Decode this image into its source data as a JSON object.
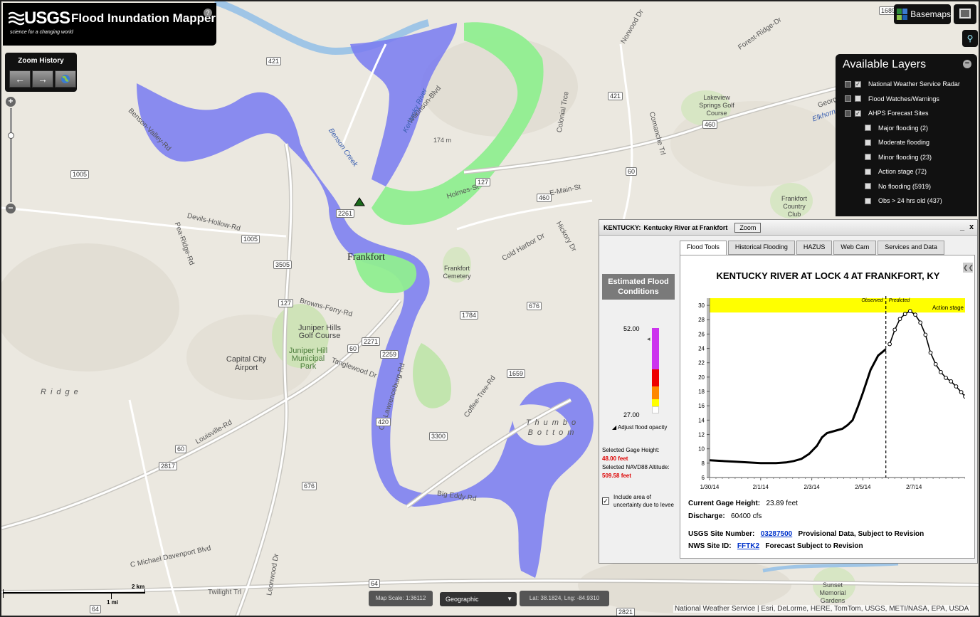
{
  "header": {
    "logo": "USGS",
    "tagline": "science for a changing world",
    "title": "Flood Inundation Mapper",
    "help": "?"
  },
  "zoom_history": {
    "label": "Zoom History",
    "back": "←",
    "forward": "→"
  },
  "zoom_slider": {
    "plus": "+",
    "minus": "−"
  },
  "basemaps": {
    "label": "Basemaps"
  },
  "layers": {
    "title": "Available Layers",
    "items": [
      {
        "label": "National Weather Service Radar",
        "checked": true,
        "level": 0
      },
      {
        "label": "Flood Watches/Warnings",
        "checked": false,
        "level": 0
      },
      {
        "label": "AHPS Forecast Sites",
        "checked": true,
        "level": 0
      },
      {
        "label": "Major flooding (2)",
        "checked": false,
        "level": 1
      },
      {
        "label": "Moderate flooding",
        "checked": false,
        "level": 1
      },
      {
        "label": "Minor flooding (23)",
        "checked": false,
        "level": 1
      },
      {
        "label": "Action stage (72)",
        "checked": false,
        "level": 1
      },
      {
        "label": "No flooding (5919)",
        "checked": false,
        "level": 1
      },
      {
        "label": "Obs > 24 hrs old (437)",
        "checked": false,
        "level": 1
      }
    ]
  },
  "panel": {
    "state": "KENTUCKY:",
    "site": "Kentucky River at Frankfort",
    "zoom": "Zoom",
    "minimize": "_",
    "close": "x",
    "tabs": [
      "Flood Tools",
      "Historical Flooding",
      "HAZUS",
      "Web Cam",
      "Services and Data"
    ],
    "efc_title": "Estimated Flood Conditions",
    "scale_top": "52.00",
    "scale_bottom": "27.00",
    "adjust_opacity": "Adjust flood opacity",
    "gage_height_label": "Selected Gage Height:",
    "gage_height_value": "48.00 feet",
    "navd_label": "Selected NAVD88 Altitude:",
    "navd_value": "509.58 feet",
    "levee_text": "Include area of uncertainty due to levee",
    "levee_checked": true,
    "current_gage_label": "Current Gage Height:",
    "current_gage_value": "23.89 feet",
    "discharge_label": "Discharge:",
    "discharge_value": "60400 cfs",
    "usgs_site_label": "USGS Site Number:",
    "usgs_site_link": "03287500",
    "usgs_site_note": "Provisional Data, Subject to Revision",
    "nws_site_label": "NWS Site ID:",
    "nws_site_link": "FFTK2",
    "nws_site_note": "Forecast Subject to Revision"
  },
  "chart_data": {
    "type": "line",
    "title": "KENTUCKY RIVER AT LOCK 4 AT FRANKFORT, KY",
    "x_ticks": [
      "1/30/14",
      "2/1/14",
      "2/3/14",
      "2/5/14",
      "2/7/14"
    ],
    "ylim": [
      6,
      31
    ],
    "y_ticks": [
      6,
      8,
      10,
      12,
      14,
      16,
      18,
      20,
      22,
      24,
      26,
      28,
      30
    ],
    "action_stage": {
      "from": 29,
      "to": 31,
      "label": "Action stage",
      "color": "#ffff00"
    },
    "divider_label_left": "Observed",
    "divider_label_right": "Predicted",
    "divider_x": 6.9,
    "observed": [
      [
        0,
        8.4
      ],
      [
        0.5,
        8.3
      ],
      [
        1,
        8.2
      ],
      [
        1.5,
        8.1
      ],
      [
        2,
        8.0
      ],
      [
        2.6,
        8.0
      ],
      [
        3.0,
        8.1
      ],
      [
        3.3,
        8.3
      ],
      [
        3.6,
        8.6
      ],
      [
        3.9,
        9.3
      ],
      [
        4.2,
        10.4
      ],
      [
        4.4,
        11.6
      ],
      [
        4.6,
        12.2
      ],
      [
        4.9,
        12.5
      ],
      [
        5.2,
        12.8
      ],
      [
        5.4,
        13.3
      ],
      [
        5.6,
        14.0
      ],
      [
        5.8,
        15.8
      ],
      [
        6.0,
        17.8
      ],
      [
        6.3,
        21.0
      ],
      [
        6.6,
        23.0
      ],
      [
        6.9,
        23.89
      ]
    ],
    "predicted": [
      [
        7.05,
        24.6
      ],
      [
        7.25,
        26.6
      ],
      [
        7.45,
        28.1
      ],
      [
        7.65,
        28.8
      ],
      [
        7.85,
        29.2
      ],
      [
        8.05,
        28.7
      ],
      [
        8.25,
        27.6
      ],
      [
        8.45,
        25.9
      ],
      [
        8.65,
        23.4
      ],
      [
        8.85,
        21.8
      ],
      [
        9.05,
        20.7
      ],
      [
        9.25,
        19.9
      ],
      [
        9.45,
        19.4
      ],
      [
        9.65,
        18.7
      ],
      [
        9.85,
        17.9
      ],
      [
        10.0,
        17.3
      ]
    ],
    "x_max": 10.0,
    "grid": false,
    "legend": "none"
  },
  "bottom": {
    "scale_km": "2 km",
    "scale_mi": "1 mi",
    "map_scale": "Map Scale: 1:36112",
    "projection": "Geographic",
    "latlng": "Lat: 38.1824, Lng: -84.9310",
    "attribution": "National Weather Service | Esri, DeLorme, HERE, TomTom, USGS, METI/NASA, EPA, USDA"
  },
  "map": {
    "places": [
      "Frankfort",
      "Juniper Hills Golf Course",
      "Juniper Hill Municipal Park",
      "Capital City Airport",
      "Frankfort Cemetery",
      "Lakeview Springs Golf Course",
      "Frankfort Country Club",
      "Sunset Memorial Gardens"
    ],
    "roads": [
      "Devils-Hollow-Rd",
      "Louisville-Rd",
      "Holmes-St",
      "E-Main-St",
      "Wilkinson-Blvd",
      "Browns-Ferry-Rd",
      "Benson-Valley-Rd",
      "Old-Lawrenceburg-Rd",
      "Coffee-Tree-Rd",
      "C Michael Davenport Blvd",
      "Twilight Trl",
      "Big Eddy Rd",
      "Pea-Ridge-Rd",
      "Tanglewood Dr",
      "Georgetown",
      "Cold Harbor Dr",
      "Hickory Dr",
      "Leonwood Dr",
      "Norwood Dr",
      "Forest-Ridge-Dr",
      "Colonial Trce",
      "Comanche Trl"
    ],
    "water": [
      "Kentucky River",
      "Benson Creek",
      "Elkhorn Creek"
    ],
    "area": "Thumbo Bottom",
    "ridge": "Ridge",
    "elev": "174 m",
    "shields": [
      "421",
      "421",
      "1005",
      "1005",
      "3505",
      "127",
      "127",
      "60",
      "60",
      "460",
      "460",
      "2261",
      "2271",
      "2259",
      "1784",
      "676",
      "676",
      "1659",
      "420",
      "3300",
      "2817",
      "60",
      "64",
      "64",
      "2821",
      "1689"
    ]
  }
}
